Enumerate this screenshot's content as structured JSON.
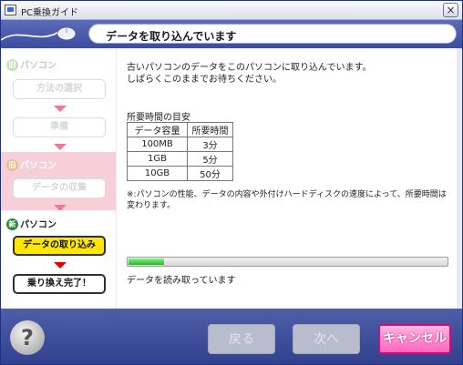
{
  "window": {
    "title": "PC乗換ガイド",
    "close_glyph": "×"
  },
  "header": {
    "title": "データを取り込んでいます"
  },
  "sidebar": {
    "section_old1_label": "パソコン",
    "section_old1_badge": "旧",
    "step_method": "方法の選択",
    "step_prepare": "準備",
    "section_old2_label": "パソコン",
    "section_old2_badge": "旧",
    "step_collect": "データの収集",
    "section_new_label": "パソコン",
    "section_new_badge": "新",
    "step_import": "データの取り込み",
    "step_complete": "乗り換え完了！"
  },
  "main": {
    "message_line1": "古いパソコンのデータをこのパソコンに取り込んでいます。",
    "message_line2": "しばらくこのままでお待ちください。",
    "table_title": "所要時間の目安",
    "table_headers": [
      "データ容量",
      "所要時間"
    ],
    "table_rows": [
      [
        "100MB",
        "3分"
      ],
      [
        "1GB",
        "5分"
      ],
      [
        "10GB",
        "50分"
      ]
    ],
    "note": "※:パソコンの性能、データの内容や外付けハードディスクの速度によって、所要時間は変わります。",
    "progress_percent": 11,
    "status": "データを読み取っています"
  },
  "footer": {
    "help_glyph": "?",
    "back_label": "戻る",
    "next_label": "次へ",
    "cancel_label": "キャンセル"
  },
  "icons": [
    "help-icon",
    "mouse-icon",
    "close-icon",
    "down-arrow-icon"
  ],
  "colors": {
    "header": "#3d4c9e",
    "active_step": "#ffe700",
    "cancel": "#ff64be",
    "progress": "#28b428"
  }
}
